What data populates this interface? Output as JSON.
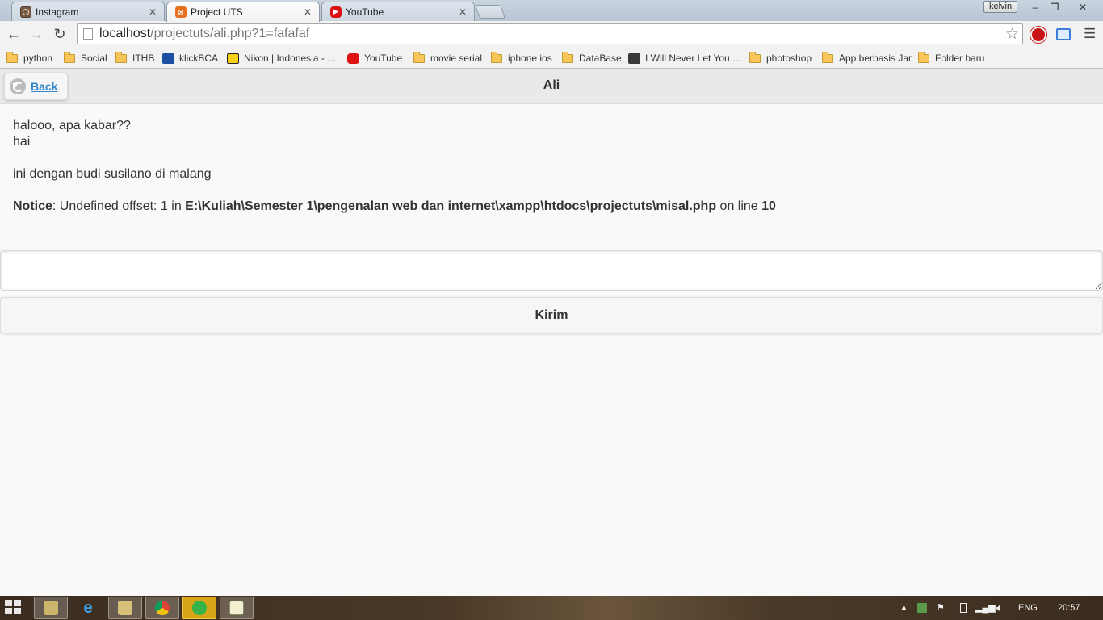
{
  "browser": {
    "tabs": [
      {
        "title": "Instagram",
        "favicon": "instagram-icon",
        "active": false
      },
      {
        "title": "Project UTS",
        "favicon": "xampp-icon",
        "active": true
      },
      {
        "title": "YouTube",
        "favicon": "youtube-icon",
        "active": false
      }
    ],
    "profile_name": "kelvin",
    "address": {
      "host": "localhost",
      "path": "/projectuts/ali.php?1=fafafaf"
    },
    "bookmarks": [
      {
        "label": "python",
        "icon": "folder-icon"
      },
      {
        "label": "Social",
        "icon": "folder-icon"
      },
      {
        "label": "ITHB",
        "icon": "folder-icon"
      },
      {
        "label": "klickBCA",
        "icon": "bca-icon"
      },
      {
        "label": "Nikon | Indonesia - ...",
        "icon": "nikon-icon"
      },
      {
        "label": "YouTube",
        "icon": "youtube-icon"
      },
      {
        "label": "movie serial",
        "icon": "folder-icon"
      },
      {
        "label": "iphone ios",
        "icon": "folder-icon"
      },
      {
        "label": "DataBase",
        "icon": "folder-icon"
      },
      {
        "label": "I Will Never Let You ...",
        "icon": "music-icon"
      },
      {
        "label": "photoshop",
        "icon": "folder-icon"
      },
      {
        "label": "App berbasis Jar",
        "icon": "folder-icon"
      },
      {
        "label": "Folder baru",
        "icon": "folder-icon"
      }
    ]
  },
  "page": {
    "back_label": "Back",
    "title": "Ali",
    "messages": [
      "halooo, apa kabar??",
      "hai",
      "ini dengan budi susilano di malang"
    ],
    "notice": {
      "label": "Notice",
      "text_1": ": Undefined offset: 1 in ",
      "file": "E:\\Kuliah\\Semester 1\\pengenalan web dan internet\\xampp\\htdocs\\projectuts\\misal.php",
      "text_2": " on line ",
      "line": "10"
    },
    "message_input_value": "",
    "send_label": "Kirim"
  },
  "taskbar": {
    "language": "ENG",
    "clock": "20:57"
  },
  "colors": {
    "link_blue": "#3388cc",
    "header_bg": "#e9e9e9",
    "page_bg": "#f9f9f9"
  }
}
